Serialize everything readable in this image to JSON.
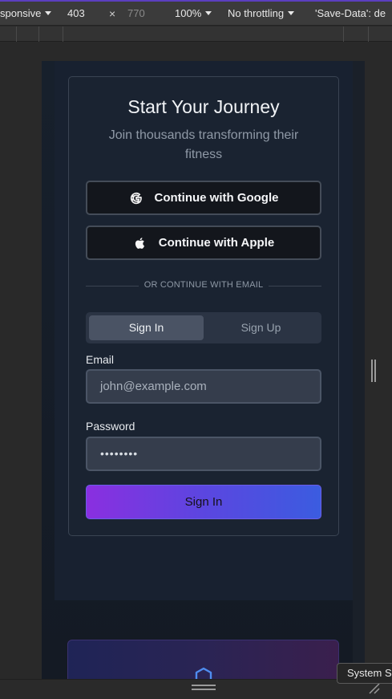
{
  "devtools": {
    "device_mode": "sponsive",
    "width": "403",
    "times": "×",
    "height": "770",
    "zoom": "100%",
    "throttling": "No throttling",
    "save_data": "'Save-Data': de",
    "tooltip": "System S"
  },
  "auth": {
    "title": "Start Your Journey",
    "subtitle": "Join thousands transforming their fitness",
    "google_label": "Continue with Google",
    "apple_label": "Continue with Apple",
    "divider_text": "OR CONTINUE WITH EMAIL",
    "tabs": [
      {
        "label": "Sign In",
        "active": true
      },
      {
        "label": "Sign Up",
        "active": false
      }
    ],
    "email_label": "Email",
    "email_placeholder": "john@example.com",
    "password_label": "Password",
    "password_value": "••••••••",
    "submit_label": "Sign In"
  },
  "colors": {
    "accent_gradient_start": "#8a2fe0",
    "accent_gradient_end": "#3b5ce0",
    "card_bg": "#1a2331"
  }
}
